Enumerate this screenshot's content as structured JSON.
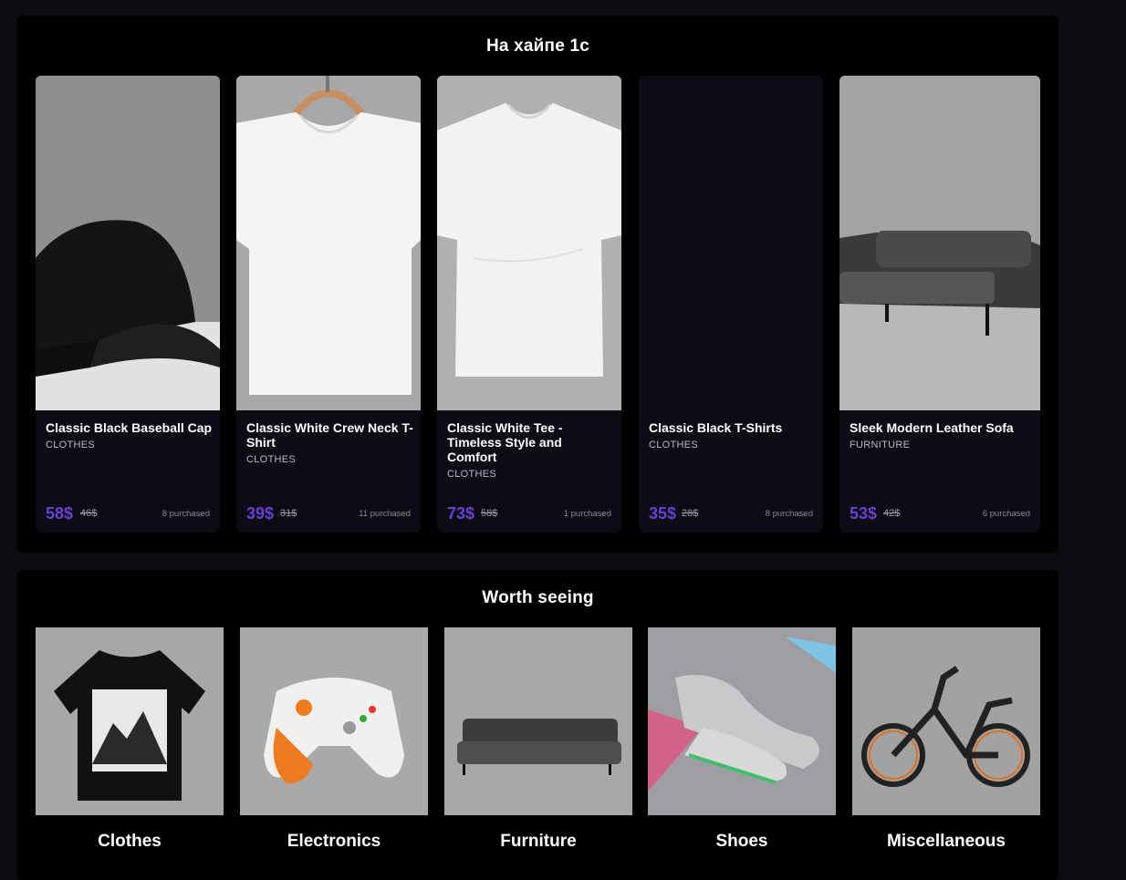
{
  "hype": {
    "title": "На хайпе 1с",
    "products": [
      {
        "name": "Classic Black Baseball Cap",
        "category": "CLOTHES",
        "price": "58$",
        "old_price": "46$",
        "purchased": "8 purchased",
        "image": "cap"
      },
      {
        "name": "Classic White Crew Neck T-Shirt",
        "category": "CLOTHES",
        "price": "39$",
        "old_price": "31$",
        "purchased": "11 purchased",
        "image": "tshirt-hanger"
      },
      {
        "name": "Classic White Tee - Timeless Style and Comfort",
        "category": "CLOTHES",
        "price": "73$",
        "old_price": "58$",
        "purchased": "1 purchased",
        "image": "tshirt"
      },
      {
        "name": "Classic Black T-Shirts",
        "category": "CLOTHES",
        "price": "35$",
        "old_price": "28$",
        "purchased": "8 purchased",
        "image": "none"
      },
      {
        "name": "Sleek Modern Leather Sofa",
        "category": "FURNITURE",
        "price": "53$",
        "old_price": "42$",
        "purchased": "6 purchased",
        "image": "sofa"
      }
    ]
  },
  "worth": {
    "title": "Worth seeing",
    "categories": [
      {
        "label": "Clothes",
        "image": "tshirt-mountains"
      },
      {
        "label": "Electronics",
        "image": "gamepad"
      },
      {
        "label": "Furniture",
        "image": "sofa"
      },
      {
        "label": "Shoes",
        "image": "sneakers"
      },
      {
        "label": "Miscellaneous",
        "image": "ebike"
      }
    ]
  },
  "colors": {
    "page_bg": "#0b0b12",
    "section_bg": "#000000",
    "card_bg": "#0c0c14",
    "price_accent": "#6a3fd6"
  }
}
